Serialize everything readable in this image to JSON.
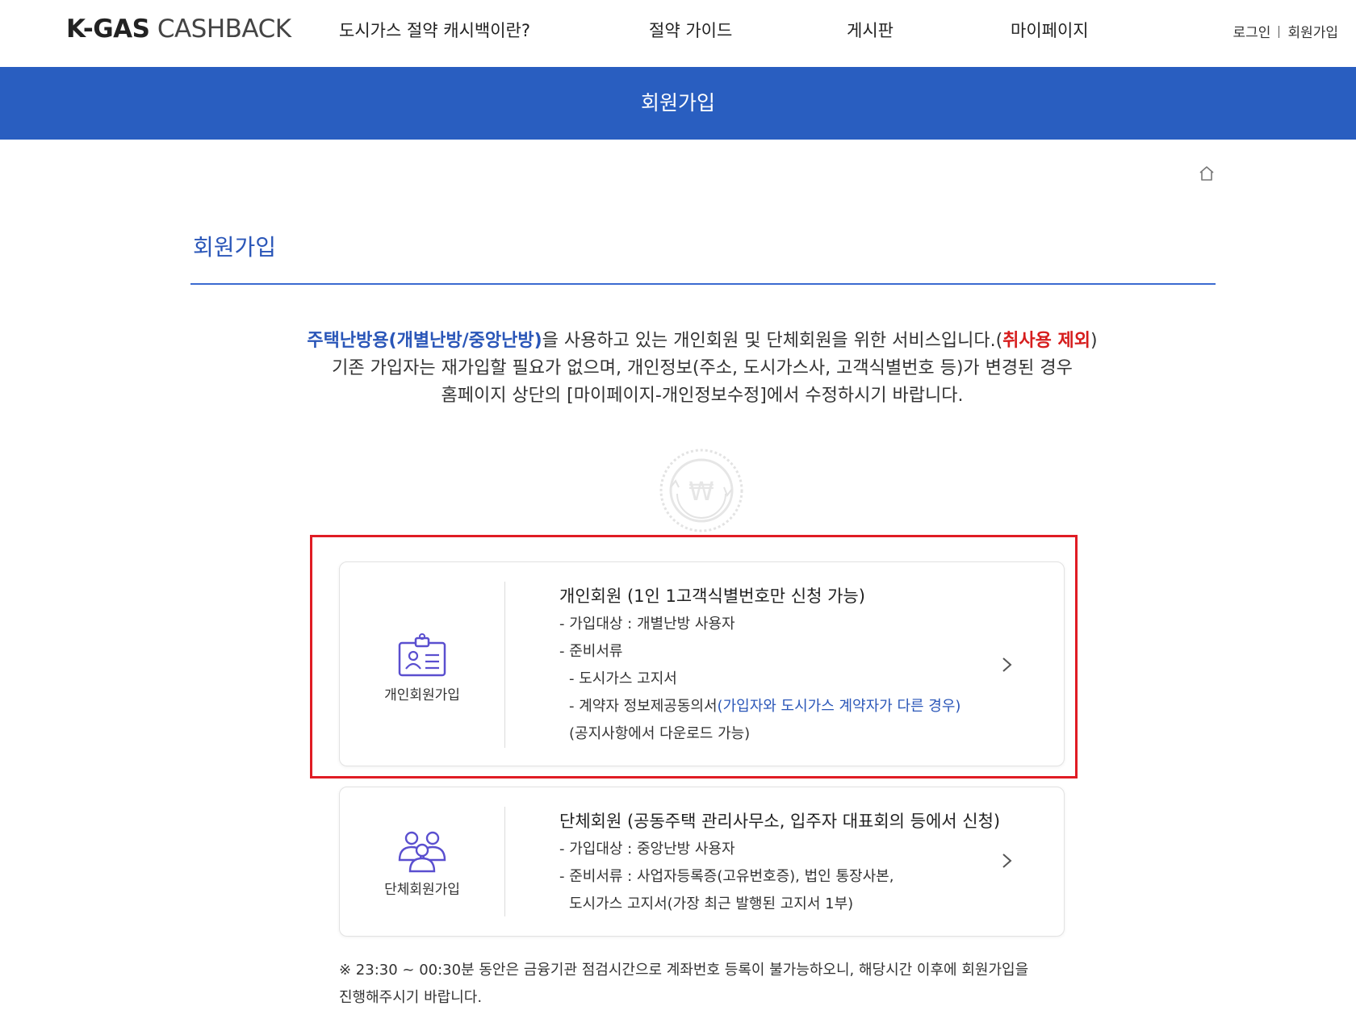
{
  "header": {
    "logo_bold": "K-GAS",
    "logo_light": " CASHBACK",
    "nav": [
      {
        "label": "도시가스 절약 캐시백이란?"
      },
      {
        "label": "절약 가이드"
      },
      {
        "label": "게시판"
      },
      {
        "label": "마이페이지"
      }
    ],
    "util": {
      "login": "로그인",
      "signup": "회원가입"
    }
  },
  "banner": {
    "title": "회원가입"
  },
  "page": {
    "title": "회원가입"
  },
  "intro": {
    "line1_blue": "주택난방용(개별난방/중앙난방)",
    "line1_text": "을 사용하고 있는 개인회원 및 단체회원을 위한 서비스입니다.(",
    "line1_red": "취사용 제외",
    "line1_end": ")",
    "line2": "기존 가입자는 재가입할 필요가 없으며, 개인정보(주소, 도시가스사, 고객식별번호 등)가 변경된 경우",
    "line3": "홈페이지 상단의 [마이페이지-개인정보수정]에서 수정하시기 바랍니다."
  },
  "cards": {
    "personal": {
      "icon_label": "개인회원가입",
      "head": "개인회원 (1인 1고객식별번호만 신청 가능)",
      "target": "- 가입대상 : 개별난방 사용자",
      "docs_label": "- 준비서류",
      "doc1": "- 도시가스 고지서",
      "doc2_text": "- 계약자 정보제공동의서",
      "doc2_blue": "(가입자와 도시가스 계약자가 다른 경우)",
      "doc2_note": "(공지사항에서 다운로드 가능)"
    },
    "group": {
      "icon_label": "단체회원가입",
      "head": "단체회원 (공동주택 관리사무소, 입주자 대표회의 등에서 신청)",
      "target": "- 가입대상 : 중앙난방 사용자",
      "docs": "- 준비서류 : 사업자등록증(고유번호증), 법인 통장사본,",
      "docs2": "도시가스 고지서(가장 최근 발행된 고지서 1부)"
    }
  },
  "notice": {
    "line1": "※ 23:30 ~ 00:30분 동안은 금융기관 점검시간으로 계좌번호 등록이 불가능하오니, 해당시간 이후에 회원가입을",
    "line2": "진행해주시기 바랍니다."
  },
  "colors": {
    "brand_blue": "#295ec0",
    "accent_blue": "#2a56b8",
    "red": "#d61d1d",
    "highlight": "#e01c24",
    "icon_purple": "#5a4fcf"
  }
}
